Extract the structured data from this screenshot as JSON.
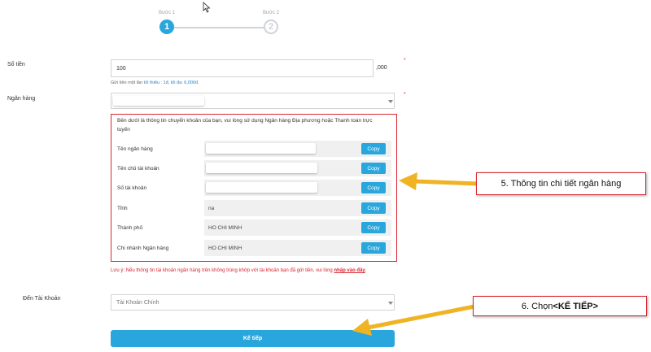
{
  "stepper": {
    "step1_label": "Bước 1",
    "step1_number": "1",
    "step2_label": "Bước 2",
    "step2_number": "2"
  },
  "amount": {
    "label": "Số tiền",
    "value": "100",
    "suffix": ",000",
    "required_mark": "*",
    "hint_prefix": "Gửi tiền một lần ",
    "hint_min": "tối thiểu : 1đ, tối đa: 6,000đ."
  },
  "bank": {
    "label": "Ngân hàng",
    "required_mark": "*"
  },
  "bank_panel": {
    "intro": "Bên dưới là thông tin chuyển khoản của bạn, vui lòng sử dụng Ngân hàng Địa phương hoặc Thanh toán trực tuyến",
    "rows": [
      {
        "label": "Tên ngân hàng",
        "value": "",
        "copy": "Copy"
      },
      {
        "label": "Tên chủ tài khoản",
        "value": "",
        "copy": "Copy"
      },
      {
        "label": "Số tài khoản",
        "value": "",
        "copy": "Copy"
      },
      {
        "label": "Tỉnh",
        "value": "na",
        "copy": "Copy"
      },
      {
        "label": "Thành phố",
        "value": "HO CHI MINH",
        "copy": "Copy"
      },
      {
        "label": "Chi nhánh Ngân hàng",
        "value": "HO CHI MINH",
        "copy": "Copy"
      }
    ]
  },
  "warning": {
    "text": "Lưu ý: Nếu thông tin tài khoản ngân hàng trên không trùng khớp với tài khoản bạn đã gửi tiền, vui lòng ",
    "link": "nhấp vào đây",
    "end": "."
  },
  "to_account": {
    "label": "Đến Tài Khoản",
    "selected": "Tài Khoản Chính"
  },
  "next_button": "Kế tiếp",
  "callouts": {
    "bank_info": "5. Thông tin chi tiết ngân hàng",
    "next_prefix": "6. Chọn ",
    "next_bold": "<KẾ TIẾP>"
  },
  "colors": {
    "accent": "#29a6dc",
    "highlight": "#d9252f",
    "arrow": "#f0b323"
  }
}
